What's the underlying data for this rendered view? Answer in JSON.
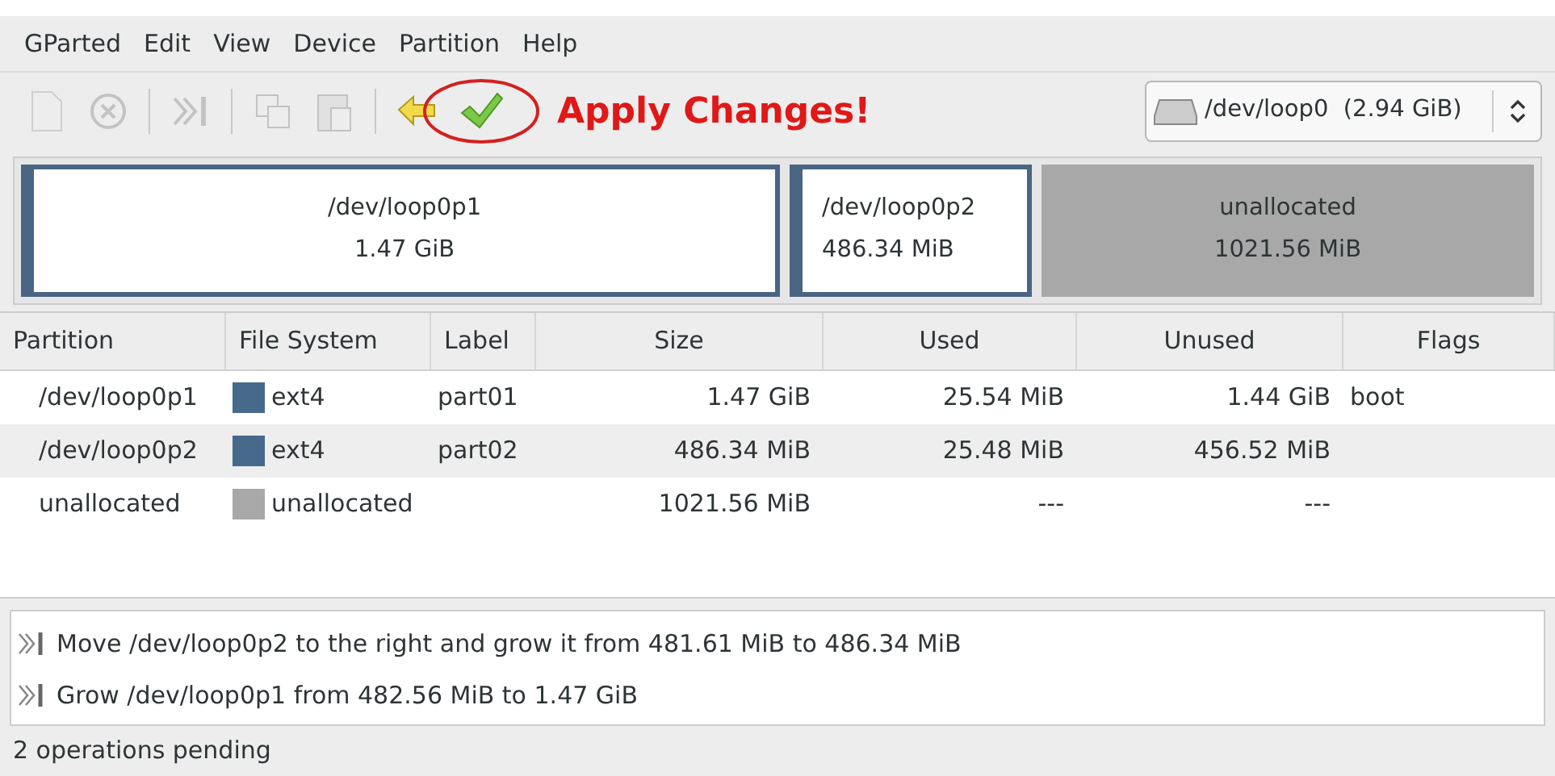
{
  "menu": [
    "GParted",
    "Edit",
    "View",
    "Device",
    "Partition",
    "Help"
  ],
  "toolbar": [
    {
      "kind": "new",
      "disabled": true
    },
    {
      "kind": "delete",
      "disabled": true
    },
    {
      "kind": "sep"
    },
    {
      "kind": "resize",
      "disabled": true
    },
    {
      "kind": "sep"
    },
    {
      "kind": "copy",
      "disabled": true
    },
    {
      "kind": "paste",
      "disabled": true
    },
    {
      "kind": "sep"
    },
    {
      "kind": "undo",
      "disabled": false
    },
    {
      "kind": "apply",
      "disabled": false
    }
  ],
  "annotation": "Apply Changes!",
  "device": {
    "label": "/dev/loop0  (2.94 GiB)"
  },
  "map": [
    {
      "kind": "partition",
      "name": "/dev/loop0p1",
      "size": "1.47 GiB"
    },
    {
      "kind": "partition",
      "name": "/dev/loop0p2",
      "size": "486.34 MiB"
    },
    {
      "kind": "unallocated",
      "name": "unallocated",
      "size": "1021.56 MiB"
    }
  ],
  "table": {
    "columns": [
      "Partition",
      "File System",
      "Label",
      "Size",
      "Used",
      "Unused",
      "Flags"
    ],
    "rows": [
      {
        "partition": "/dev/loop0p1",
        "fs": "ext4",
        "color": "#47698c",
        "label": "part01",
        "size": "1.47 GiB",
        "used": "25.54 MiB",
        "unused": "1.44 GiB",
        "flags": "boot"
      },
      {
        "partition": "/dev/loop0p2",
        "fs": "ext4",
        "color": "#47698c",
        "label": "part02",
        "size": "486.34 MiB",
        "used": "25.48 MiB",
        "unused": "456.52 MiB"
      },
      {
        "partition": "unallocated",
        "fs": "unallocated",
        "color": "#a8a8a8",
        "size": "1021.56 MiB",
        "used": "---",
        "unused": "---"
      }
    ]
  },
  "operations": [
    "Move /dev/loop0p2 to the right and grow it from 481.61 MiB to 486.34 MiB",
    "Grow /dev/loop0p1 from 482.56 MiB to 1.47 GiB"
  ],
  "status_bar": "2 operations pending"
}
